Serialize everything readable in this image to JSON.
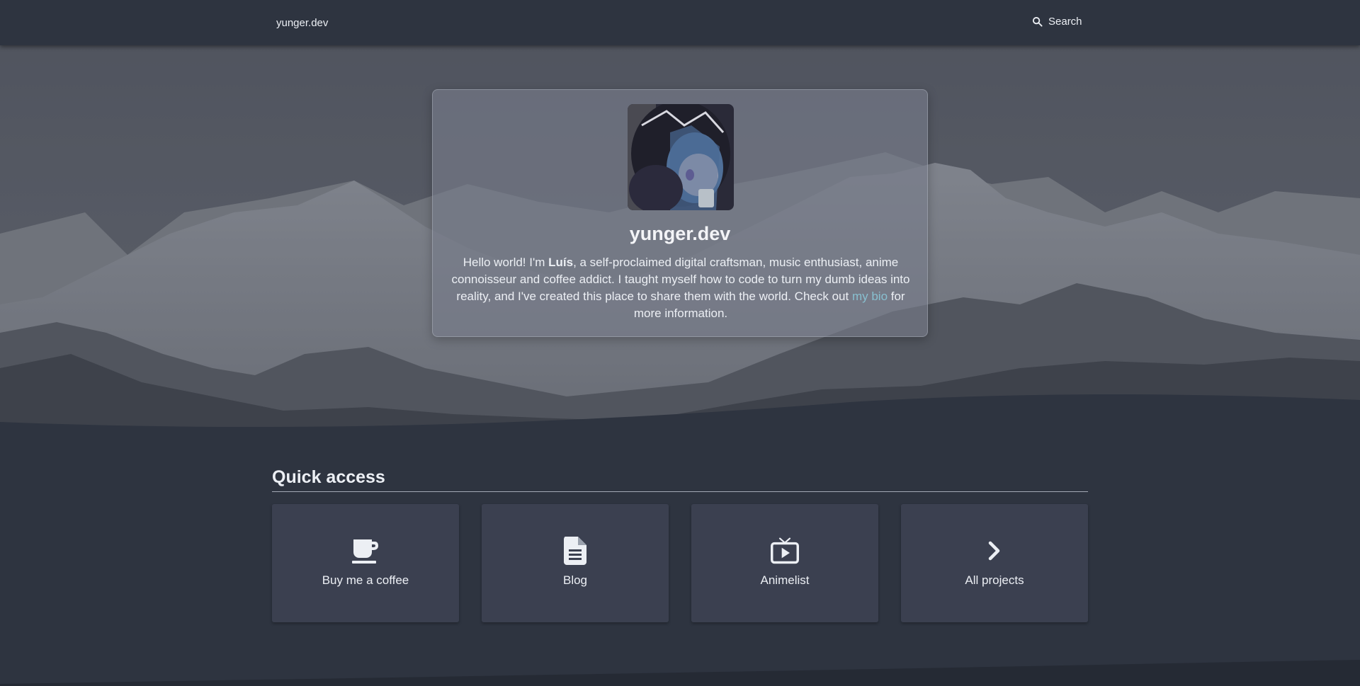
{
  "nav": {
    "brand": "yunger.dev",
    "search_label": "Search",
    "search_icon": "magnifier-icon"
  },
  "hero": {
    "title": "yunger.dev",
    "intro": {
      "before_name": "Hello world! I'm ",
      "name": "Luís",
      "after_name": ", a self-proclaimed digital craftsman, music enthusiast, anime connoisseur and coffee addict. I taught myself how to code to turn my dumb ideas into reality, and I've created this place to share them with the world. Check out ",
      "link_text": "my bio",
      "after_link": " for more information."
    }
  },
  "quick_access": {
    "title": "Quick access",
    "tiles": [
      {
        "label": "Buy me a coffee",
        "icon": "coffee-mug-icon"
      },
      {
        "label": "Blog",
        "icon": "document-icon"
      },
      {
        "label": "Animelist",
        "icon": "tv-play-icon"
      },
      {
        "label": "All projects",
        "icon": "chevron-right-icon"
      }
    ]
  },
  "colors": {
    "background": "#2e3440",
    "tile": "#3b4050",
    "link": "#88c0d0",
    "text": "#eceff4"
  }
}
